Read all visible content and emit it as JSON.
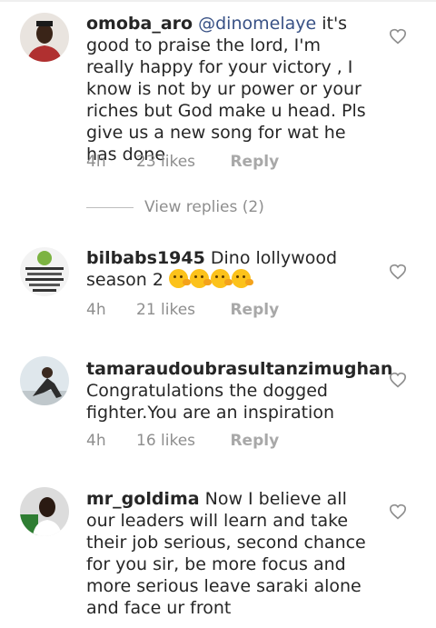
{
  "comments": [
    {
      "username": "omoba_aro",
      "mention": "@dinomelaye",
      "text": " it's good to praise the lord, I'm really happy for your victory , I know is not by ur power or your riches but God make u head. Pls give us a new song for wat he has done",
      "time": "4h",
      "likes": "23 likes",
      "reply": "Reply",
      "avatar_color": "#b03030"
    },
    {
      "username": "bilbabs1945",
      "text": " Dino lollywood season 2",
      "emoji": [
        "thinking-face",
        "thinking-face",
        "thinking-face",
        "thinking-face"
      ],
      "time": "4h",
      "likes": "21 likes",
      "reply": "Reply",
      "avatar_color": "#7cb342"
    },
    {
      "username": "tamaraudoubrasultanzimughan",
      "text": "Congratulations the dogged fighter.You are an inspiration",
      "time": "4h",
      "likes": "16 likes",
      "reply": "Reply",
      "avatar_color": "#c7d3db"
    },
    {
      "username": "mr_goldima",
      "text": " Now I believe all our leaders will learn and take their job serious, second chance for you sir, be more focus and more serious leave saraki alone and face ur front",
      "avatar_color": "#2e7d32"
    }
  ],
  "view_replies": "View replies (2)",
  "icons": {
    "like": "heart-outline-icon",
    "emoji": "thinking-face-emoji"
  }
}
